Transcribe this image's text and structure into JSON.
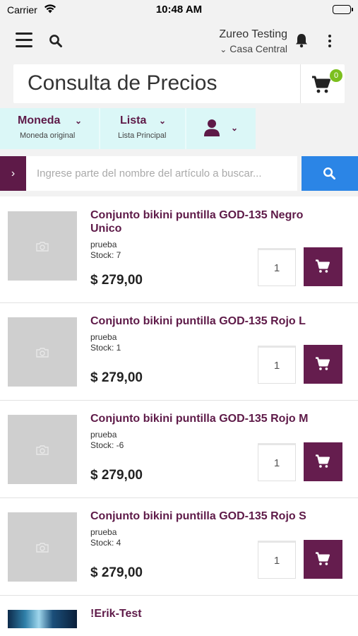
{
  "status_bar": {
    "carrier": "Carrier",
    "time": "10:48 AM"
  },
  "nav": {
    "account_name": "Zureo Testing",
    "branch": "Casa Central"
  },
  "title": "Consulta de Precios",
  "cart": {
    "count": "0"
  },
  "filters": {
    "currency": {
      "label": "Moneda",
      "value": "Moneda original"
    },
    "list": {
      "label": "Lista",
      "value": "Lista Principal"
    }
  },
  "search": {
    "placeholder": "Ingrese parte del nombre del artículo a buscar..."
  },
  "products": [
    {
      "name": "Conjunto bikini puntilla GOD-135 Negro Unico",
      "desc": "prueba",
      "stock": "Stock: 7",
      "price": "$ 279,00",
      "qty": "1"
    },
    {
      "name": "Conjunto bikini puntilla GOD-135 Rojo L",
      "desc": "prueba",
      "stock": "Stock: 1",
      "price": "$ 279,00",
      "qty": "1"
    },
    {
      "name": "Conjunto bikini puntilla GOD-135 Rojo M",
      "desc": "prueba",
      "stock": "Stock: -6",
      "price": "$ 279,00",
      "qty": "1"
    },
    {
      "name": "Conjunto bikini puntilla GOD-135 Rojo S",
      "desc": "prueba",
      "stock": "Stock: 4",
      "price": "$ 279,00",
      "qty": "1"
    },
    {
      "name": "!Erik-Test"
    }
  ],
  "colors": {
    "brand": "#5e1a48",
    "accent_blue": "#2b85e6",
    "badge_green": "#7cbf1e",
    "filter_bg": "#dbf7f7"
  }
}
